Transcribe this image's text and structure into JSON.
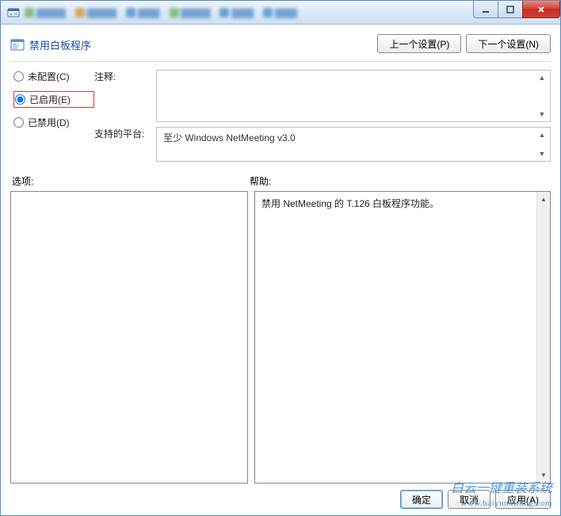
{
  "window": {
    "title": "禁用白板程序"
  },
  "header": {
    "policy_title": "禁用白板程序",
    "prev_btn": "上一个设置(P)",
    "next_btn": "下一个设置(N)"
  },
  "radios": {
    "not_configured": "未配置(C)",
    "enabled": "已启用(E)",
    "disabled": "已禁用(D)"
  },
  "labels": {
    "comment": "注释:",
    "platform": "支持的平台:",
    "options": "选项:",
    "help": "帮助:"
  },
  "platform_text": "至少 Windows NetMeeting v3.0",
  "help_text": "禁用 NetMeeting 的 T.126 白板程序功能。",
  "footer": {
    "ok": "确定",
    "cancel": "取消",
    "apply": "应用(A)"
  },
  "watermark": {
    "line1": "白云一键重装系统",
    "line2": "www.baiyunxitong.com"
  }
}
